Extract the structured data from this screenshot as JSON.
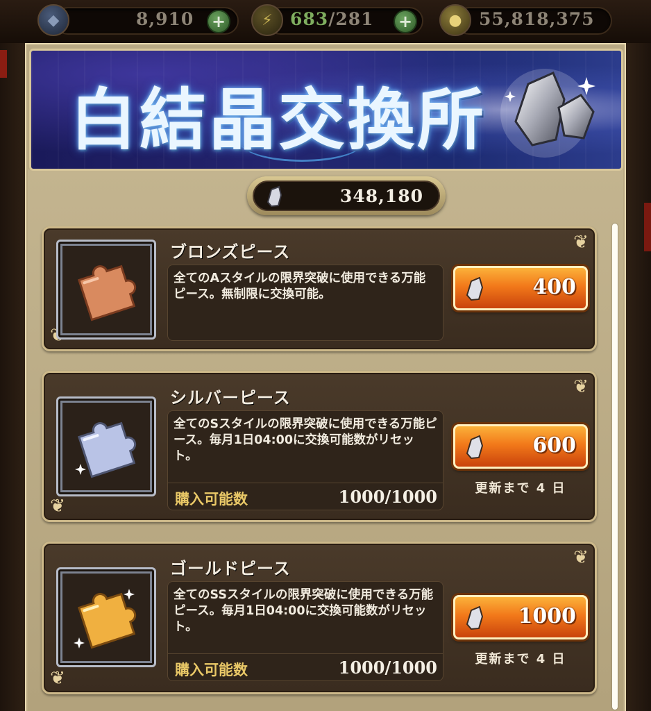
{
  "currencies": {
    "gems": {
      "value": "8,910",
      "icon": "gem-icon"
    },
    "stamina": {
      "current": "683",
      "max": "/281",
      "icon": "lightning-icon"
    },
    "gold": {
      "value": "55,818,375",
      "icon": "coin-icon"
    },
    "plus_symbol": "+"
  },
  "shop": {
    "title": "白結晶交換所",
    "balance": "348,180",
    "balance_icon": "white-crystal-icon"
  },
  "items": [
    {
      "name": "ブロンズピース",
      "description": "全てのAスタイルの限界突破に使用できる万能ピース。無制限に交換可能。",
      "price": "400",
      "color": "#d98a5f"
    },
    {
      "name": "シルバーピース",
      "description": "全てのSスタイルの限界突破に使用できる万能ピース。毎月1日04:00に交換可能数がリセット。",
      "price": "600",
      "limit_label": "購入可能数",
      "limit_value": "1000/1000",
      "refresh": "更新まで 4 日",
      "color": "#b9c3e6"
    },
    {
      "name": "ゴールドピース",
      "description": "全てのSSスタイルの限界突破に使用できる万能ピース。毎月1日04:00に交換可能数がリセット。",
      "price": "1000",
      "limit_label": "購入可能数",
      "limit_value": "1000/1000",
      "refresh": "更新まで 4 日",
      "color": "#f0b040"
    }
  ]
}
